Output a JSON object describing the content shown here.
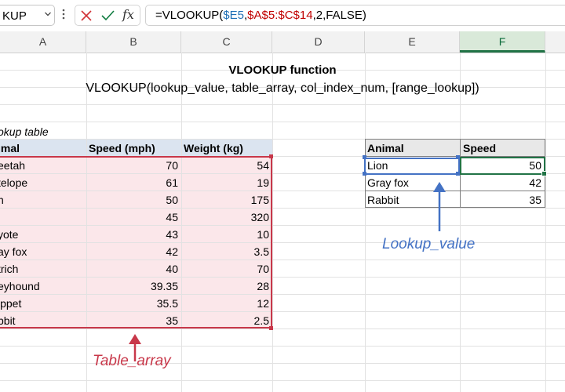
{
  "formula_bar": {
    "name_box": "KUP",
    "formula_prefix": "=VLOOKUP(",
    "formula_arg1": "$E5",
    "formula_sep1": ",",
    "formula_arg2": "$A$5:$C$14",
    "formula_rest": ",2,FALSE)",
    "fx_label": "fx"
  },
  "columns": [
    "A",
    "B",
    "C",
    "D",
    "E",
    "F"
  ],
  "selected_column": "F",
  "title": "VLOOKUP function",
  "syntax": "VLOOKUP(lookup_value, table_array, col_index_num, [range_lookup])",
  "lookup_table": {
    "caption": "okup table",
    "headers": [
      "imal",
      "Speed (mph)",
      "Weight (kg)"
    ],
    "rows": [
      [
        "eetah",
        "70",
        "54"
      ],
      [
        "telope",
        "61",
        "19"
      ],
      [
        "n",
        "50",
        "175"
      ],
      [
        "",
        "45",
        "320"
      ],
      [
        "yote",
        "43",
        "10"
      ],
      [
        "ay fox",
        "42",
        "3.5"
      ],
      [
        "trich",
        "40",
        "70"
      ],
      [
        "eyhound",
        "39.35",
        "28"
      ],
      [
        "ippet",
        "35.5",
        "12"
      ],
      [
        "bbit",
        "35",
        "2.5"
      ]
    ]
  },
  "result_table": {
    "headers": [
      "Animal",
      "Speed"
    ],
    "rows": [
      [
        "Lion",
        "50"
      ],
      [
        "Gray fox",
        "42"
      ],
      [
        "Rabbit",
        "35"
      ]
    ]
  },
  "annotations": {
    "table_array": "Table_array",
    "lookup_value": "Lookup_value"
  },
  "colors": {
    "table_array": "#c8384a",
    "lookup_value": "#4472c4",
    "active_cell": "#217346"
  }
}
